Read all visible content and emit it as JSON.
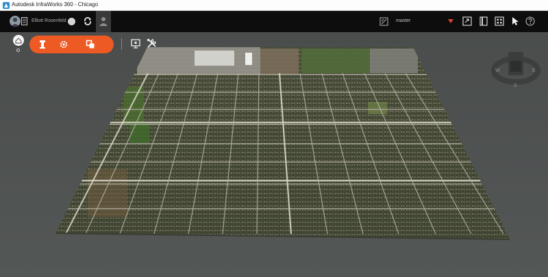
{
  "window": {
    "title": "Autodesk InfraWorks 360 - Chicago"
  },
  "toolbar": {
    "user_name": "Elliott Rosenfeld",
    "proposal_name": "master",
    "icons": [
      "avatar",
      "document-icon",
      "status-dot-icon",
      "sync-icon",
      "user-icon",
      "proposal-icon",
      "dropdown-arrow-icon",
      "share-icon",
      "book-icon",
      "grid-icon",
      "cursor-icon",
      "help-icon"
    ]
  },
  "ribbon": {
    "buttons": [
      "build-manage-analyze-icon",
      "settings-gear-icon",
      "layers-icon"
    ],
    "extra": [
      "presentation-icon",
      "tools-icon"
    ]
  },
  "compass": {
    "labels": [
      "W",
      "E",
      "S"
    ]
  },
  "colors": {
    "accent": "#ee5a24",
    "toolbar": "#0d0d0d",
    "viewport": "#4d5150"
  }
}
